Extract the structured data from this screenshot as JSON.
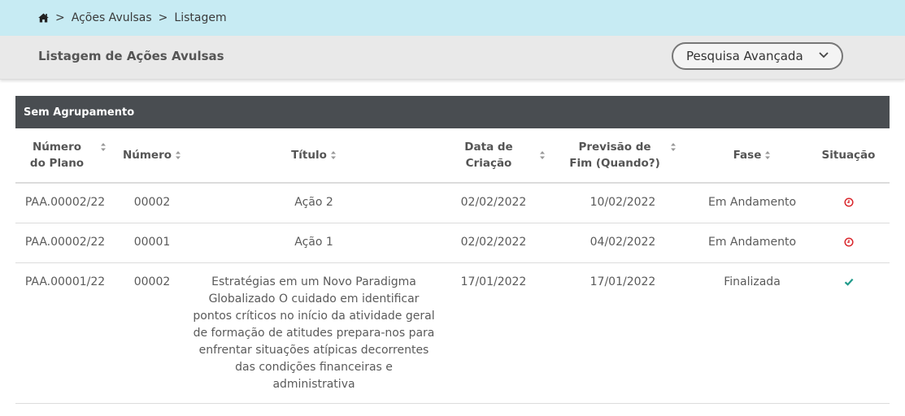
{
  "breadcrumb": {
    "home_icon": "home-icon",
    "separator": ">",
    "items": [
      "Ações Avulsas",
      "Listagem"
    ]
  },
  "header": {
    "title": "Listagem de Ações Avulsas",
    "advanced_search_label": "Pesquisa Avançada"
  },
  "group": {
    "label": "Sem Agrupamento"
  },
  "table": {
    "columns": {
      "numero_plano": "Número do Plano",
      "numero": "Número",
      "titulo": "Título",
      "data_criacao": "Data de Criação",
      "previsao_fim": "Previsão de Fim (Quando?)",
      "fase": "Fase",
      "situacao": "Situação"
    },
    "rows": [
      {
        "numero_plano": "PAA.00002/22",
        "numero": "00002",
        "titulo": "Ação 2",
        "data_criacao": "02/02/2022",
        "previsao_fim": "10/02/2022",
        "fase": "Em Andamento",
        "situacao": "clock-icon"
      },
      {
        "numero_plano": "PAA.00002/22",
        "numero": "00001",
        "titulo": "Ação 1",
        "data_criacao": "02/02/2022",
        "previsao_fim": "04/02/2022",
        "fase": "Em Andamento",
        "situacao": "clock-icon"
      },
      {
        "numero_plano": "PAA.00001/22",
        "numero": "00002",
        "titulo": "Estratégias em um Novo Paradigma Globalizado O cuidado em identificar pontos críticos no início da atividade geral de formação de atitudes prepara-nos para enfrentar situações atípicas decorrentes das condições financeiras e administrativa",
        "data_criacao": "17/01/2022",
        "previsao_fim": "17/01/2022",
        "fase": "Finalizada",
        "situacao": "check-icon"
      }
    ]
  },
  "colors": {
    "breadcrumb_bg": "#c7ebf3",
    "header_bg": "#e9e9e9",
    "group_bar_bg": "#494d51",
    "status_pending": "#d9262c",
    "status_done": "#1f9a8a"
  }
}
